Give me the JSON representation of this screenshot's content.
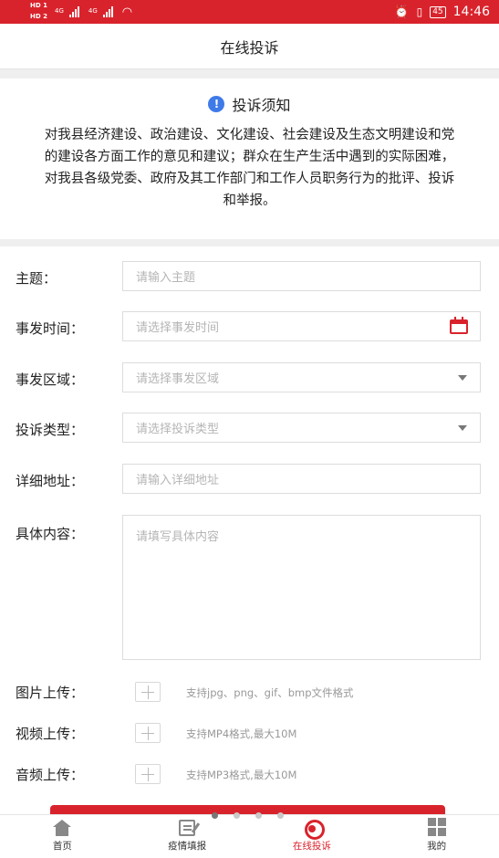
{
  "status_bar": {
    "hd_top": "HD 1",
    "hd_bottom": "HD 2",
    "net_1": "4G",
    "net_2": "4G",
    "battery": "45",
    "time": "14:46"
  },
  "header": {
    "title": "在线投诉"
  },
  "notice": {
    "title": "投诉须知",
    "icon": "info-icon",
    "text": "对我县经济建设、政治建设、文化建设、社会建设及生态文明建设和党的建设各方面工作的意见和建议；群众在生产生活中遇到的实际困难，对我县各级党委、政府及其工作部门和工作人员职务行为的批评、投诉和举报。"
  },
  "form": {
    "subject": {
      "label": "主题：",
      "placeholder": "请输入主题"
    },
    "incident_time": {
      "label": "事发时间：",
      "placeholder": "请选择事发时间"
    },
    "incident_area": {
      "label": "事发区域：",
      "placeholder": "请选择事发区域"
    },
    "complaint_type": {
      "label": "投诉类型：",
      "placeholder": "请选择投诉类型"
    },
    "address": {
      "label": "详细地址：",
      "placeholder": "请输入详细地址"
    },
    "content": {
      "label": "具体内容：",
      "placeholder": "请填写具体内容"
    },
    "image_upload": {
      "label": "图片上传：",
      "hint": "支持jpg、png、gif、bmp文件格式"
    },
    "video_upload": {
      "label": "视频上传：",
      "hint": "支持MP4格式,最大10M"
    },
    "audio_upload": {
      "label": "音频上传：",
      "hint": "支持MP3格式,最大10M"
    }
  },
  "pager": {
    "count": 4,
    "active_index": 0
  },
  "tabbar": {
    "tabs": [
      {
        "label": "首页",
        "icon": "home-icon",
        "active": false
      },
      {
        "label": "疫情填报",
        "icon": "edit-icon",
        "active": false
      },
      {
        "label": "在线投诉",
        "icon": "service-icon",
        "active": true
      },
      {
        "label": "我的",
        "icon": "grid-icon",
        "active": false
      }
    ]
  },
  "colors": {
    "brand": "#d9232c",
    "info": "#3f7be8"
  }
}
